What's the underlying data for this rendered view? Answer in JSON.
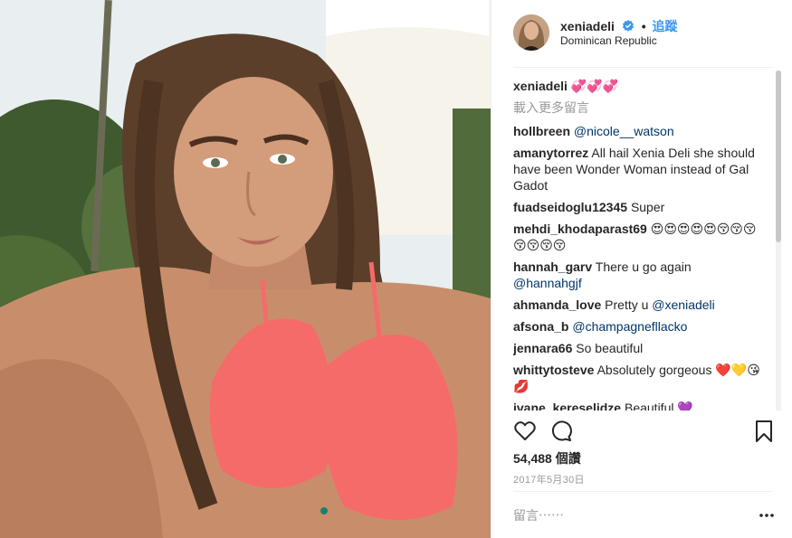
{
  "post": {
    "photo_alt": "",
    "header": {
      "username": "xeniadeli",
      "verified_icon": "verified-badge-icon",
      "separator": "•",
      "follow_label": "追蹤",
      "location": "Dominican Republic"
    },
    "caption": {
      "username": "xeniadeli",
      "text": "💞💞💞"
    },
    "load_more_label": "載入更多留言",
    "comments": [
      {
        "user": "hollbreen",
        "text": "",
        "mention": "@nicole__watson"
      },
      {
        "user": "amanytorrez",
        "text": "All hail Xenia Deli she should have been Wonder Woman instead of Gal Gadot",
        "mention": ""
      },
      {
        "user": "fuadseidoglu12345",
        "text": "Super",
        "mention": ""
      },
      {
        "user": "mehdi_khodaparast69",
        "text": "😍😍😍😍😍😚😚😚😚😚😚😚",
        "mention": ""
      },
      {
        "user": "hannah_garv",
        "text": "There u go again",
        "mention": "@hannahgjf"
      },
      {
        "user": "ahmanda_love",
        "text": "Pretty u",
        "mention": "@xeniadeli"
      },
      {
        "user": "afsona_b",
        "text": "",
        "mention": "@champagnefllacko"
      },
      {
        "user": "jennara66",
        "text": "So beautiful",
        "mention": ""
      },
      {
        "user": "whittytosteve",
        "text": "Absolutely gorgeous ❤️💛😘💋",
        "mention": ""
      },
      {
        "user": "ivane_kereselidze",
        "text": "Beautiful 💜",
        "mention": ""
      }
    ],
    "actions": {
      "like_icon": "heart-icon",
      "comment_icon": "comment-icon",
      "save_icon": "bookmark-icon"
    },
    "likes": "54,488 個讚",
    "date": "2017年5月30日",
    "comment_placeholder": "留言⋯⋯",
    "more_icon": "more-options-icon"
  },
  "colors": {
    "link": "#3897f0",
    "mention": "#003569",
    "muted": "#999999",
    "bikini": "#f56b6a"
  }
}
